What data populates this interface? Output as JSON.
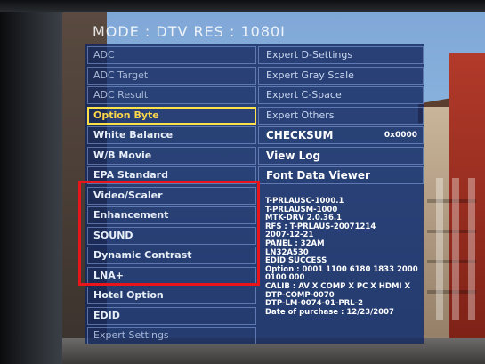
{
  "header": {
    "mode_text": "MODE : DTV   RES : 1080I"
  },
  "left_menu": [
    {
      "label": "ADC",
      "state": "dim"
    },
    {
      "label": "ADC Target",
      "state": "dim"
    },
    {
      "label": "ADC Result",
      "state": "dim"
    },
    {
      "label": "Option Byte",
      "state": "selected"
    },
    {
      "label": "White Balance",
      "state": "normal"
    },
    {
      "label": "W/B Movie",
      "state": "normal"
    },
    {
      "label": "EPA Standard",
      "state": "normal"
    },
    {
      "label": "Video/Scaler",
      "state": "normal"
    },
    {
      "label": "Enhancement",
      "state": "normal"
    },
    {
      "label": "SOUND",
      "state": "normal"
    },
    {
      "label": "Dynamic Contrast",
      "state": "normal"
    },
    {
      "label": "LNA+",
      "state": "normal"
    },
    {
      "label": "Hotel Option",
      "state": "normal"
    },
    {
      "label": "EDID",
      "state": "normal"
    },
    {
      "label": "Expert Settings",
      "state": "dim"
    }
  ],
  "right_menu": {
    "expert_d_settings": "Expert D-Settings",
    "expert_gray_scale": "Expert Gray Scale",
    "expert_c_space": "Expert C-Space",
    "expert_others": "Expert Others",
    "checksum_label": "CHECKSUM",
    "checksum_value": "0x0000",
    "view_log": "View Log",
    "font_data_viewer": "Font Data Viewer"
  },
  "info_lines": [
    "T-PRLAUSC-1000.1",
    "T-PRLAUSM-1000",
    "MTK-DRV 2.0.36.1",
    "RFS : T-PRLAUS-20071214",
    "2007-12-21",
    "PANEL : 32AM",
    "LN32A530",
    "EDID SUCCESS",
    "Option : 0001 1100 6180 1833 2000",
    "0100 000",
    "CALIB : AV X COMP X PC X HDMI X",
    "DTP-COMP-0070",
    "DTP-LM-0074-01-PRL-2",
    "Date of purchase : 12/23/2007"
  ],
  "colors": {
    "panel": "#142a5f",
    "selected_border": "#ffe14a",
    "highlight_box": "#e8151b"
  }
}
